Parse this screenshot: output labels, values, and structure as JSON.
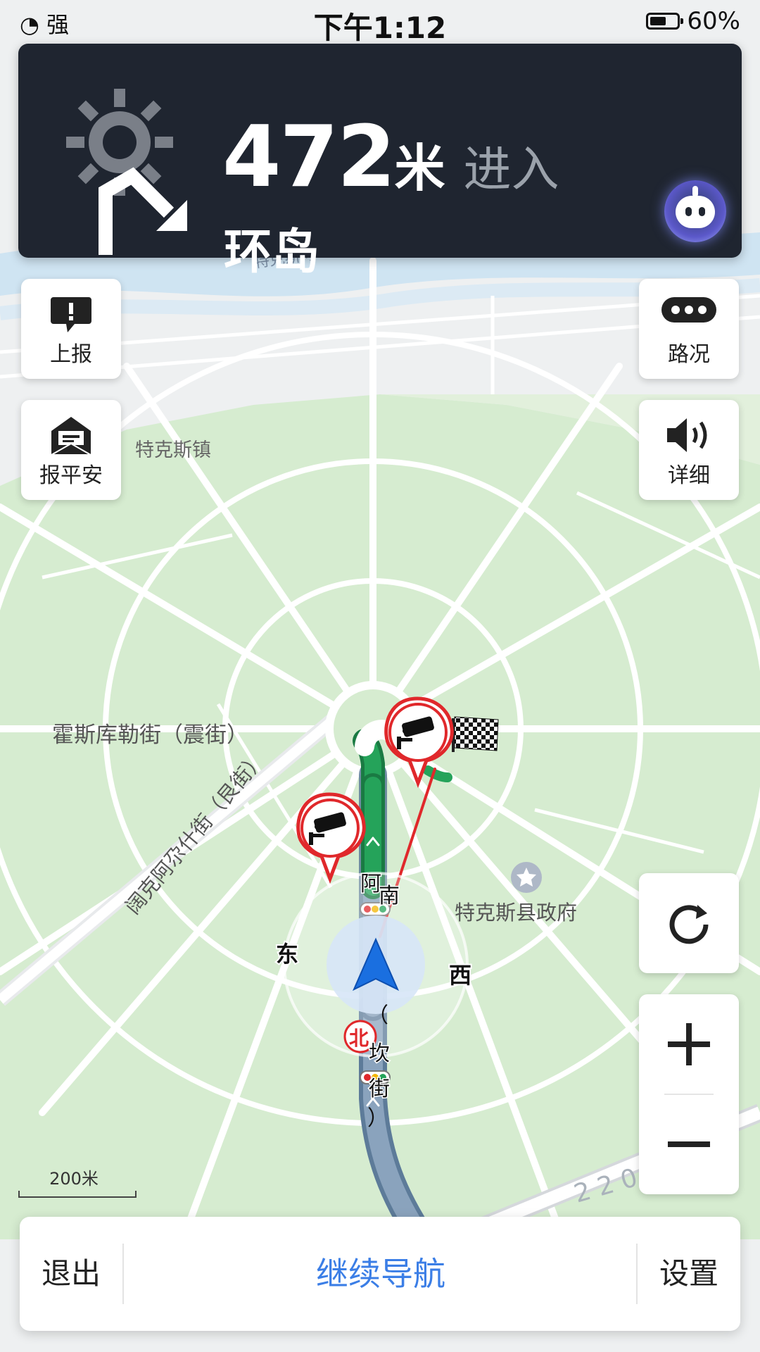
{
  "status_bar": {
    "signal_label": "强",
    "time": "下午1:12",
    "battery_text": "60%",
    "battery_level": 0.6
  },
  "banner": {
    "distance": "472",
    "unit": "米",
    "action": "进入",
    "road": "环岛",
    "turn_icon": "roundabout-turn-right-icon",
    "assistant_icon": "voice-assistant-icon"
  },
  "left_buttons": [
    {
      "label": "上报",
      "icon": "report-icon"
    },
    {
      "label": "报平安",
      "icon": "safety-message-icon"
    }
  ],
  "right_buttons": [
    {
      "label": "路况",
      "icon": "traffic-icon"
    },
    {
      "label": "详细",
      "icon": "speaker-icon"
    }
  ],
  "map": {
    "labels": {
      "river_road": "特克斯河",
      "town": "特克斯镇",
      "street_west": "霍斯库勒街（震街）",
      "street_diag": "阔克阿尕什街（艮街）",
      "gov": "特克斯县政府",
      "south_street_a": "阿",
      "south_street_b": "南",
      "south_street_paren": "（",
      "south_street_c": "坎",
      "south_street_d": "街",
      "south_street_paren2": "）",
      "highway": "2 2 0"
    },
    "compass": {
      "east": "东",
      "west": "西",
      "north": "北"
    }
  },
  "refresh_icon": "refresh-icon",
  "zoom": {
    "plus_icon": "zoom-in-icon",
    "minus_icon": "zoom-out-icon"
  },
  "scale": {
    "label": "200米"
  },
  "bottom_bar": {
    "exit": "退出",
    "continue": "继续导航",
    "settings": "设置"
  },
  "colors": {
    "banner_bg": "#1f2530",
    "route_green": "#25a35a",
    "route_past": "#8aa3bd",
    "accent_blue": "#3b7ee6",
    "park_green": "#d8ecd1",
    "camera_red": "#e0282b"
  }
}
